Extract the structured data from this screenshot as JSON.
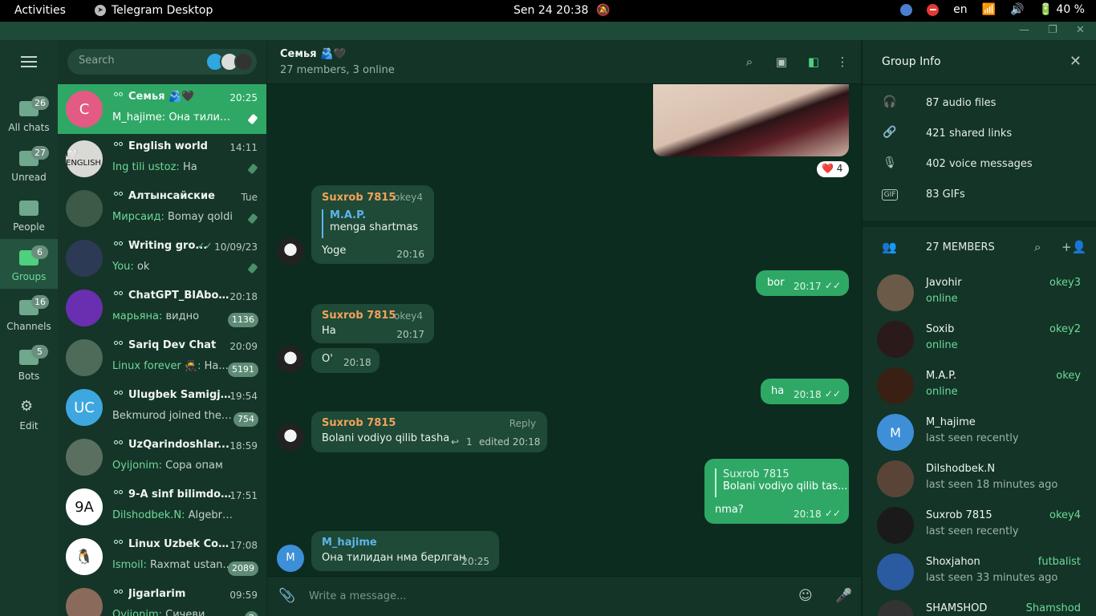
{
  "topbar": {
    "activities": "Activities",
    "app": "Telegram Desktop",
    "clock": "Sen 24  20:38",
    "lang": "en",
    "battery": "40 %"
  },
  "sidebar": {
    "folders": [
      {
        "label": "All chats",
        "badge": "26"
      },
      {
        "label": "Unread",
        "badge": "27"
      },
      {
        "label": "People",
        "badge": ""
      },
      {
        "label": "Groups",
        "badge": "6"
      },
      {
        "label": "Channels",
        "badge": "16"
      },
      {
        "label": "Bots",
        "badge": "5"
      },
      {
        "label": "Edit",
        "badge": ""
      }
    ]
  },
  "chatlist": {
    "search_placeholder": "Search",
    "chats": [
      {
        "name": "Семья 🫂🖤",
        "time": "20:25",
        "sender": "M_hajime:",
        "preview": "Она тилида...",
        "avatar_text": "С",
        "avatar_color": "#e35a82",
        "pinned": true,
        "count": ""
      },
      {
        "name": "English world",
        "time": "14:11",
        "sender": "Ing tili ustoz:",
        "preview": "Ha",
        "avatar_text": "I🤍 ENGLISH",
        "avatar_color": "#d9d9d6",
        "pinned": true,
        "count": ""
      },
      {
        "name": "Алтынсайские",
        "time": "Tue",
        "sender": "Мирсаид:",
        "preview": "Bomay qoldi",
        "avatar_text": "",
        "avatar_color": "#3d5a48",
        "pinned": true,
        "count": ""
      },
      {
        "name": "Writing gro...",
        "time": "10/09/23",
        "sender": "You:",
        "preview": "ok",
        "avatar_text": "",
        "avatar_color": "#2d3a55",
        "pinned": true,
        "count": ""
      },
      {
        "name": "ChatGPT_BIAbot ...",
        "time": "20:18",
        "sender": "марьяна:",
        "preview": "видно",
        "avatar_text": "",
        "avatar_color": "#6a2fb0",
        "pinned": false,
        "count": "1136"
      },
      {
        "name": "Sariq Dev Chat",
        "time": "20:09",
        "sender": "Linux forever 🥷:",
        "preview": "Ha...",
        "avatar_text": "",
        "avatar_color": "#4d6b58",
        "pinned": false,
        "count": "5191"
      },
      {
        "name": "Ulugbek Samigjo...",
        "time": "19:54",
        "sender": "",
        "preview": "Bekmurod joined the ...",
        "avatar_text": "UC",
        "avatar_color": "#3ea7e0",
        "pinned": false,
        "count": "754"
      },
      {
        "name": "UzQarindoshlar...",
        "time": "18:59",
        "sender": "Oyijonim:",
        "preview": "Сора опам",
        "avatar_text": "",
        "avatar_color": "#5a6f5f",
        "pinned": false,
        "count": ""
      },
      {
        "name": "9-A sinf bilimdonl...",
        "time": "17:51",
        "sender": "Dilshodbek.N:",
        "preview": "Algebradan u...",
        "avatar_text": "9A",
        "avatar_color": "#ffffff",
        "pinned": false,
        "count": ""
      },
      {
        "name": "Linux Uzbek Com...",
        "time": "17:08",
        "sender": "Ismoil:",
        "preview": "Raxmat ustan...",
        "avatar_text": "🐧",
        "avatar_color": "#ffffff",
        "pinned": false,
        "count": "2089"
      },
      {
        "name": "Jigarlarim",
        "time": "09:59",
        "sender": "Oyijonim:",
        "preview": "Сичеви",
        "avatar_text": "",
        "avatar_color": "#8a6a5a",
        "pinned": false,
        "count": "2"
      }
    ]
  },
  "chat": {
    "title": "Семья 🫂🖤",
    "subtitle": "27 members, 3 online",
    "reaction": "❤️ 4",
    "messages": {
      "m1_author": "Suxrob 7815",
      "m1_rank": "okey4",
      "m1_quote_author": "M.A.P.",
      "m1_quote_text": "menga shartmas",
      "m1_text": "Yoge",
      "m1_time": "20:16",
      "m2_text": "bor",
      "m2_time": "20:17",
      "m3_author": "Suxrob 7815",
      "m3_rank": "okey4",
      "m3_text": "Ha",
      "m3_time": "20:17",
      "m4_text": "O'",
      "m4_time": "20:18",
      "m5_text": "ha",
      "m5_time": "20:18",
      "m6_author": "Suxrob 7815",
      "m6_reply": "Reply",
      "m6_text": "Bolani vodiyo qilib tasha",
      "m6_replies": "1",
      "m6_time": "edited 20:18",
      "m7_quote_author": "Suxrob 7815",
      "m7_quote_text": "Bolani vodiyo qilib tas...",
      "m7_text": "nma?",
      "m7_time": "20:18",
      "m8_author": "M_hajime",
      "m8_text": "Она тилидан нма берлган",
      "m8_time": "20:25",
      "m8_avatar": "M"
    },
    "composer_placeholder": "Write a message..."
  },
  "info": {
    "title": "Group Info",
    "media": [
      "87 audio files",
      "421 shared links",
      "402 voice messages",
      "83 GIFs"
    ],
    "members_header": "27 MEMBERS",
    "members": [
      {
        "name": "Javohir",
        "status": "online",
        "rank": "okey3",
        "online": true,
        "avatar_text": "",
        "color": "#6b5a48"
      },
      {
        "name": "Soxib",
        "status": "online",
        "rank": "okey2",
        "online": true,
        "avatar_text": "",
        "color": "#2a1a1a"
      },
      {
        "name": "M.A.P.",
        "status": "online",
        "rank": "okey",
        "online": true,
        "avatar_text": "",
        "color": "#3a2014"
      },
      {
        "name": "M_hajime",
        "status": "last seen recently",
        "rank": "",
        "online": false,
        "avatar_text": "M",
        "color": "#3d8fd8"
      },
      {
        "name": "Dilshodbek.N",
        "status": "last seen 18 minutes ago",
        "rank": "",
        "online": false,
        "avatar_text": "",
        "color": "#5a4438"
      },
      {
        "name": "Suxrob 7815",
        "status": "last seen recently",
        "rank": "okey4",
        "online": false,
        "avatar_text": "",
        "color": "#1a1a1a"
      },
      {
        "name": "Shoxjahon",
        "status": "last seen 33 minutes ago",
        "rank": "futbalist",
        "online": false,
        "avatar_text": "",
        "color": "#2a5aa0"
      },
      {
        "name": "SHAMSHOD",
        "status": "",
        "rank": "Shamshod",
        "online": false,
        "avatar_text": "",
        "color": "#333333"
      }
    ]
  }
}
